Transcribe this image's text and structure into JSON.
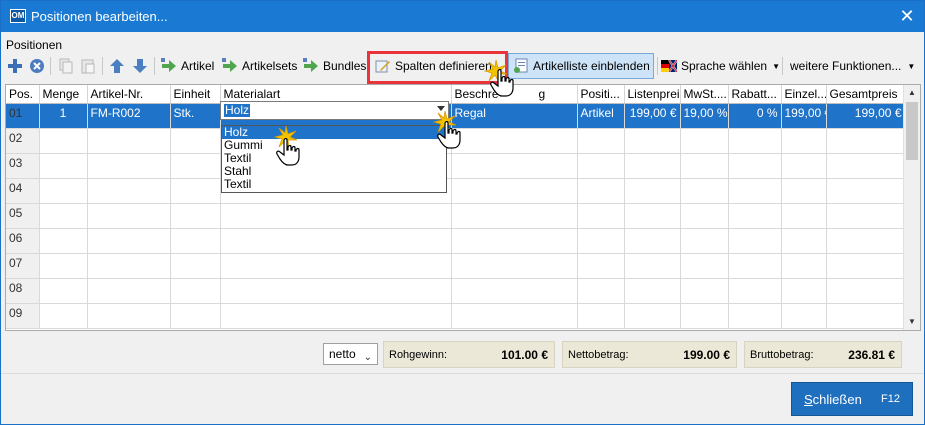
{
  "window": {
    "app_icon_text": "OM",
    "title": "Positionen bearbeiten...",
    "close_glyph": "✕"
  },
  "section_label": "Positionen",
  "toolbar": {
    "artikel": "Artikel",
    "artikelsets": "Artikelsets",
    "bundles": "Bundles",
    "spalten_definieren": "Spalten definieren",
    "artikelliste_einblenden": "Artikelliste einblenden",
    "sprache_waehlen": "Sprache wählen",
    "weitere_funktionen": "weitere Funktionen..."
  },
  "table": {
    "columns": [
      "Pos.",
      "Menge",
      "Artikel-Nr.",
      "Einheit",
      "Materialart",
      "Beschreibung",
      "Positi...",
      "Listenpreis",
      "MwSt....",
      "Rabatt...",
      "Einzel...",
      "Gesamtpreis"
    ],
    "header_visible": {
      "beschreibung": "Beschre",
      "beschreibung_tail": "g"
    },
    "rows": [
      {
        "pos": "01",
        "menge": "1",
        "artikel_nr": "FM-R002",
        "einheit": "Stk.",
        "materialart": "Holz",
        "beschreibung": "Regal",
        "position": "Artikel",
        "listenpreis": "199,00 €",
        "mwst": "19,00 %",
        "rabatt": "0 %",
        "einzel": "199,00 €",
        "gesamt": "199,00 €"
      },
      {
        "pos": "02"
      },
      {
        "pos": "03"
      },
      {
        "pos": "04"
      },
      {
        "pos": "05"
      },
      {
        "pos": "06"
      },
      {
        "pos": "07"
      },
      {
        "pos": "08"
      },
      {
        "pos": "09"
      }
    ]
  },
  "material_editor": {
    "value": "Holz",
    "options": [
      "Holz",
      "Gummi",
      "Textil",
      "Stahl",
      "Textil"
    ],
    "selected": "Holz"
  },
  "footer": {
    "netto_select": "netto",
    "rohgewinn_label": "Rohgewinn:",
    "rohgewinn_value": "101.00 €",
    "nettobetrag_label": "Nettobetrag:",
    "nettobetrag_value": "199.00 €",
    "bruttobetrag_label": "Bruttobetrag:",
    "bruttobetrag_value": "236.81 €"
  },
  "close_button": {
    "label_underlined": "S",
    "label_rest": "chließen",
    "key": "F12"
  },
  "colors": {
    "titlebar": "#1979d3",
    "selection": "#1f73c8",
    "highlight": "#e8343a",
    "sum_box": "#ebe8d7"
  }
}
